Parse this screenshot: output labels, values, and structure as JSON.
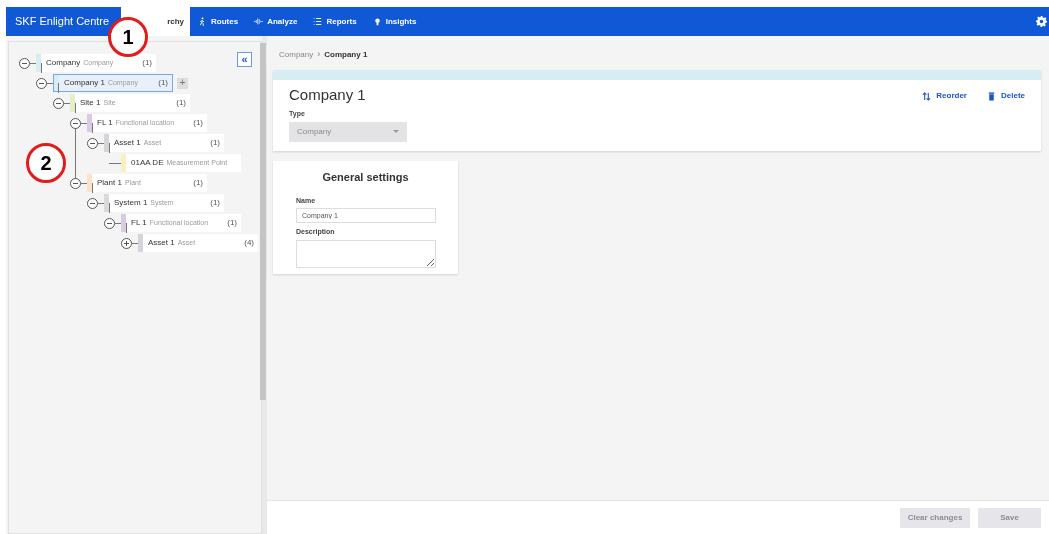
{
  "app": {
    "brand": "SKF Enlight Centre"
  },
  "nav": [
    {
      "label": "rchy",
      "selected": true
    },
    {
      "label": "Routes",
      "selected": false
    },
    {
      "label": "Analyze",
      "selected": false
    },
    {
      "label": "Reports",
      "selected": false
    },
    {
      "label": "Insights",
      "selected": false
    }
  ],
  "collapse_button": "«",
  "tree": [
    {
      "name": "Company",
      "type": "Company",
      "count": "(1)",
      "color": "#d6eef3",
      "expanded": true,
      "selected": false,
      "children": [
        {
          "name": "Company 1",
          "type": "Company",
          "count": "(1)",
          "color": "#d6eef3",
          "expanded": true,
          "selected": true,
          "add": "+",
          "children": [
            {
              "name": "Site 1",
              "type": "Site",
              "count": "(1)",
              "color": "#e4efc6",
              "expanded": true,
              "selected": false,
              "children": [
                {
                  "name": "FL 1",
                  "type": "Functional location",
                  "count": "(1)",
                  "color": "#dcc9e5",
                  "expanded": true,
                  "selected": false,
                  "children": [
                    {
                      "name": "Asset 1",
                      "type": "Asset",
                      "count": "(1)",
                      "color": "#d2d6da",
                      "expanded": true,
                      "selected": false,
                      "children": [
                        {
                          "name": "01AA DE",
                          "type": "Measurement Point",
                          "color": "#fbefc2",
                          "selected": false
                        }
                      ]
                    }
                  ]
                },
                {
                  "name": "Plant 1",
                  "type": "Plant",
                  "count": "(1)",
                  "color": "#fde1c9",
                  "expanded": true,
                  "selected": false,
                  "children": [
                    {
                      "name": "System 1",
                      "type": "System",
                      "count": "(1)",
                      "color": "#dcdad8",
                      "expanded": true,
                      "selected": false,
                      "children": [
                        {
                          "name": "FL 1",
                          "type": "Functional location",
                          "count": "(1)",
                          "color": "#dcc9e5",
                          "expanded": true,
                          "selected": false,
                          "children": [
                            {
                              "name": "Asset 1",
                              "type": "Asset",
                              "count": "(4)",
                              "color": "#d2d6da",
                              "expanded": false,
                              "selected": false
                            }
                          ]
                        }
                      ]
                    }
                  ]
                }
              ]
            }
          ]
        }
      ]
    }
  ],
  "breadcrumb": {
    "separator": "›",
    "items": [
      {
        "label": "Company",
        "current": false
      },
      {
        "label": "Company 1",
        "current": true
      }
    ]
  },
  "detail": {
    "title": "Company 1",
    "actions": [
      "Reorder",
      "Delete"
    ],
    "type_label": "Type",
    "type_value": "Company"
  },
  "general_settings": {
    "title": "General settings",
    "fields": [
      {
        "label": "Name",
        "value": "Company 1",
        "kind": "text"
      },
      {
        "label": "Description",
        "kind": "textarea"
      }
    ]
  },
  "footer_buttons": [
    {
      "label": "Clear changes",
      "disabled": true
    },
    {
      "label": "Save",
      "disabled": true
    }
  ],
  "callouts": [
    {
      "label": "1"
    },
    {
      "label": "2"
    }
  ]
}
